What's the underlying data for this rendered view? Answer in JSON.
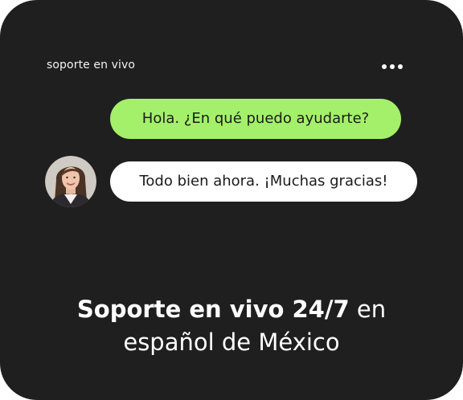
{
  "header": {
    "title": "soporte en vivo",
    "menu_icon": "more-horizontal-icon"
  },
  "chat": {
    "messages": [
      {
        "sender": "agent",
        "text": "Hola. ¿En qué puedo ayudarte?",
        "color": "#a4f06a"
      },
      {
        "sender": "user",
        "text": "Todo bien ahora. ¡Muchas gracias!",
        "color": "#ffffff"
      }
    ],
    "user_avatar_icon": "user-avatar-photo"
  },
  "headline": {
    "bold_part": "Soporte en vivo 24/7",
    "regular_part_line1": " en",
    "line2": "español de México"
  },
  "colors": {
    "background": "#1f1f1f",
    "accent": "#a4f06a",
    "text": "#ffffff"
  }
}
